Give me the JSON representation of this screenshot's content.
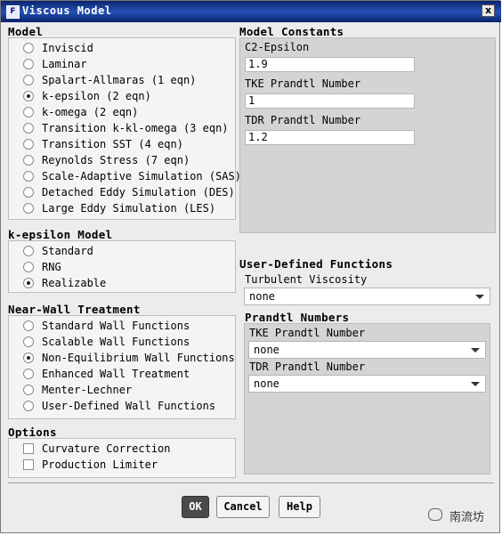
{
  "window": {
    "title": "Viscous Model",
    "app_icon": "F",
    "close_glyph": "x"
  },
  "model": {
    "heading": "Model",
    "options": [
      "Inviscid",
      "Laminar",
      "Spalart-Allmaras (1 eqn)",
      "k-epsilon (2 eqn)",
      "k-omega (2 eqn)",
      "Transition k-kl-omega (3 eqn)",
      "Transition SST (4 eqn)",
      "Reynolds Stress (7 eqn)",
      "Scale-Adaptive Simulation (SAS)",
      "Detached Eddy Simulation (DES)",
      "Large Eddy Simulation (LES)"
    ],
    "selected": "k-epsilon (2 eqn)"
  },
  "ke_model": {
    "heading": "k-epsilon Model",
    "options": [
      "Standard",
      "RNG",
      "Realizable"
    ],
    "selected": "Realizable"
  },
  "near_wall": {
    "heading": "Near-Wall Treatment",
    "options": [
      "Standard Wall Functions",
      "Scalable Wall Functions",
      "Non-Equilibrium Wall Functions",
      "Enhanced Wall Treatment",
      "Menter-Lechner",
      "User-Defined Wall Functions"
    ],
    "selected": "Non-Equilibrium Wall Functions"
  },
  "options": {
    "heading": "Options",
    "items": [
      {
        "label": "Curvature Correction",
        "checked": false
      },
      {
        "label": "Production Limiter",
        "checked": false
      }
    ]
  },
  "constants": {
    "heading": "Model Constants",
    "fields": [
      {
        "label": "C2-Epsilon",
        "value": "1.9"
      },
      {
        "label": "TKE Prandtl Number",
        "value": "1"
      },
      {
        "label": "TDR Prandtl Number",
        "value": "1.2"
      }
    ]
  },
  "udf": {
    "heading": "User-Defined Functions",
    "turb_label": "Turbulent Viscosity",
    "turb_value": "none",
    "prandtl_heading": "Prandtl Numbers",
    "tke_label": "TKE Prandtl Number",
    "tke_value": "none",
    "tdr_label": "TDR Prandtl Number",
    "tdr_value": "none"
  },
  "buttons": {
    "ok": "OK",
    "cancel": "Cancel",
    "help": "Help"
  },
  "watermark": {
    "text": "南流坊"
  }
}
